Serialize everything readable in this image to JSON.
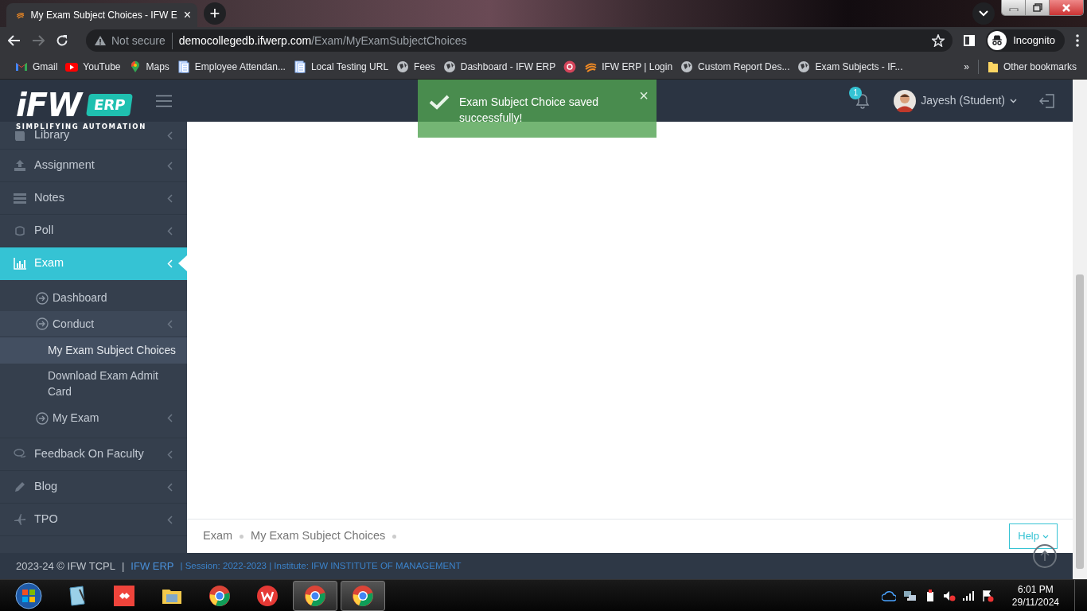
{
  "browser": {
    "tabs": [
      {
        "title": "My Exam Subject Choices - IFW E",
        "selected": true,
        "close": "×"
      }
    ],
    "new_tab": "+",
    "address": {
      "security": "Not secure",
      "host": "democollegedb.ifwerp.com",
      "path": "/Exam/MyExamSubjectChoices"
    },
    "profile": "Incognito",
    "bookmarks": [
      {
        "kind": "gmail",
        "label": "Gmail"
      },
      {
        "kind": "youtube",
        "label": "YouTube"
      },
      {
        "kind": "maps",
        "label": "Maps"
      },
      {
        "kind": "doc",
        "label": "Employee Attendan..."
      },
      {
        "kind": "doc",
        "label": "Local Testing URL"
      },
      {
        "kind": "globe",
        "label": "Fees"
      },
      {
        "kind": "globe",
        "label": "Dashboard - IFW ERP"
      },
      {
        "kind": "dot"
      },
      {
        "kind": "ifw",
        "label": "IFW ERP | Login"
      },
      {
        "kind": "globe",
        "label": "Custom Report Des..."
      },
      {
        "kind": "globe",
        "label": "Exam Subjects - IF..."
      }
    ],
    "bookmarks_overflow": "»",
    "other_bookmarks": "Other bookmarks"
  },
  "app": {
    "logo": {
      "wordmark": "iFW",
      "badge": "ERP",
      "tagline": "SIMPLIFYING AUTOMATION"
    },
    "toast": {
      "message": "Exam Subject Choice saved successfully!",
      "close": "×"
    },
    "notifications": {
      "count": "1"
    },
    "user": {
      "name": "Jayesh (Student)"
    },
    "sidebar": {
      "items": [
        {
          "label": "Library",
          "selected": false
        },
        {
          "label": "Assignment",
          "selected": false
        },
        {
          "label": "Notes",
          "selected": false
        },
        {
          "label": "Poll",
          "selected": false
        },
        {
          "label": "Exam",
          "selected": true,
          "expanded": true,
          "children": [
            {
              "label": "Dashboard",
              "selected": false
            },
            {
              "label": "Conduct",
              "selected": false,
              "expanded": true,
              "children": [
                {
                  "label": "My Exam Subject Choices",
                  "selected": true
                },
                {
                  "label": "Download Exam Admit Card",
                  "selected": false
                }
              ]
            },
            {
              "label": "My Exam",
              "selected": false,
              "expanded": false
            }
          ]
        },
        {
          "label": "Feedback On Faculty",
          "selected": false
        },
        {
          "label": "Blog",
          "selected": false
        },
        {
          "label": "TPO",
          "selected": false
        }
      ]
    },
    "breadcrumb": [
      "Exam",
      "My Exam Subject Choices"
    ],
    "help_button": "Help",
    "footer": {
      "copyright": "2023-24 © IFW TCPL",
      "separator": "|",
      "brand": "IFW ERP",
      "details": "| Session: 2022-2023 | Institute: IFW INSTITUTE OF MANAGEMENT"
    }
  },
  "taskbar": {
    "apps": [
      {
        "kind": "notebook",
        "selected": false
      },
      {
        "kind": "anydesk",
        "selected": false
      },
      {
        "kind": "folder",
        "selected": false
      },
      {
        "kind": "chrome",
        "selected": false
      },
      {
        "kind": "wps",
        "selected": false
      },
      {
        "kind": "chrome",
        "selected": true
      },
      {
        "kind": "chrome",
        "selected": true
      }
    ],
    "time": "6:01 PM",
    "date": "29/11/2024"
  }
}
